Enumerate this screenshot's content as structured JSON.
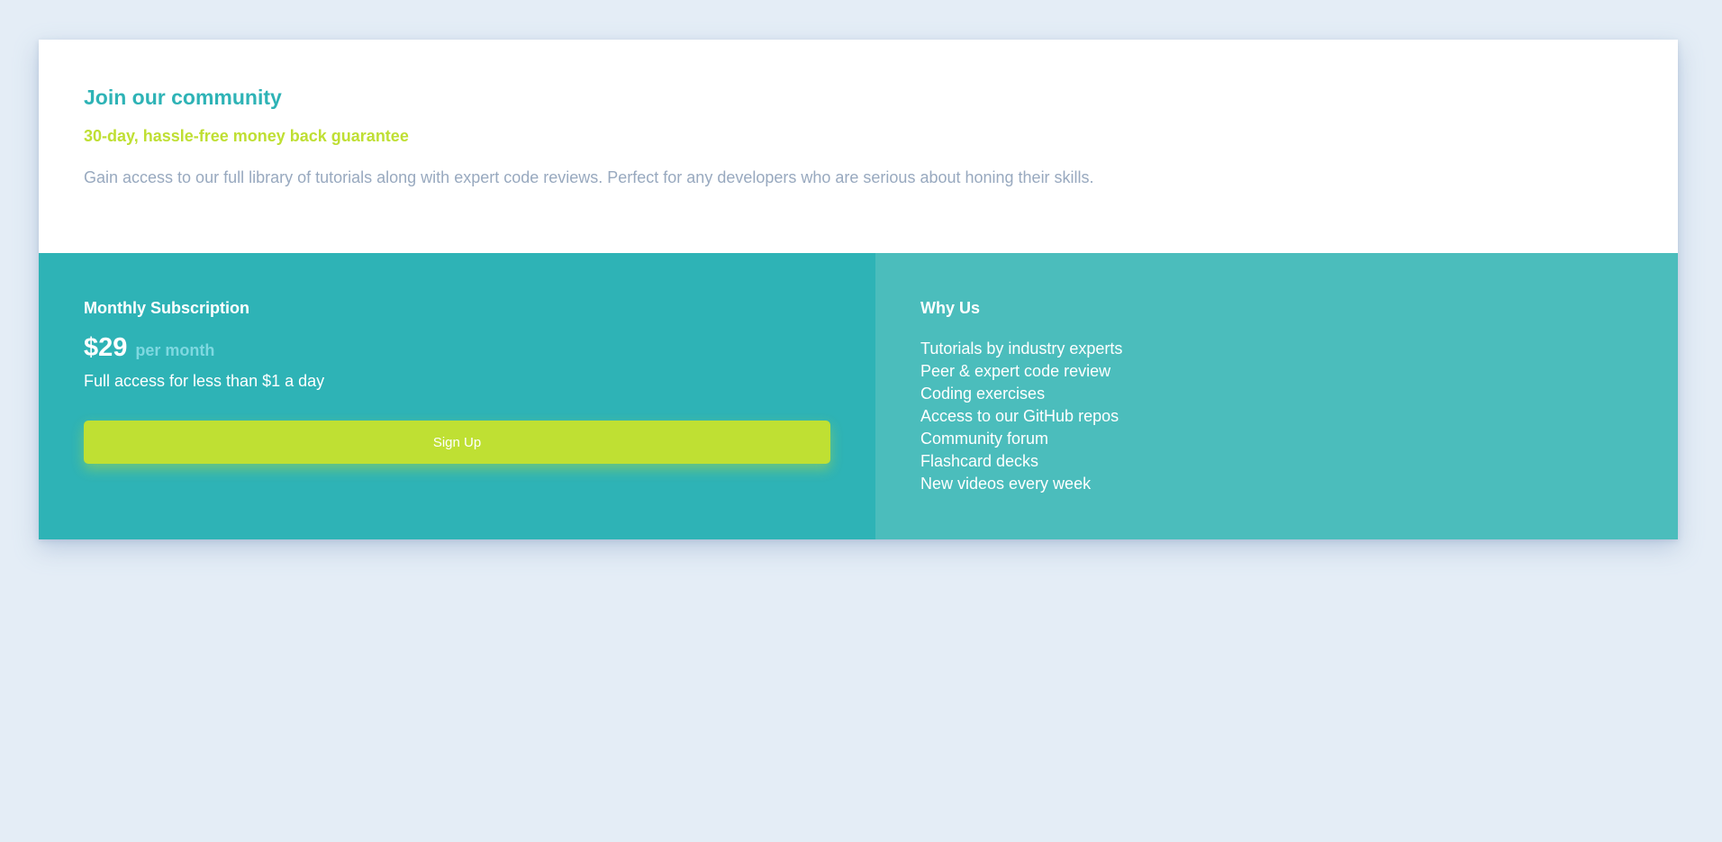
{
  "intro": {
    "title": "Join our community",
    "subtitle": "30-day, hassle-free money back guarantee",
    "description": "Gain access to our full library of tutorials along with expert code reviews. Perfect for any developers who are serious about honing their skills."
  },
  "subscription": {
    "title": "Monthly Subscription",
    "price": "$29",
    "period": "per month",
    "note": "Full access for less than $1 a day",
    "button_label": "Sign Up"
  },
  "why_us": {
    "title": "Why Us",
    "items": [
      "Tutorials by industry experts",
      "Peer & expert code review",
      "Coding exercises",
      "Access to our GitHub repos",
      "Community forum",
      "Flashcard decks",
      "New videos every week"
    ]
  },
  "colors": {
    "background": "#e4edf6",
    "primary": "#2eb3b6",
    "secondary": "#4bbdbc",
    "accent": "#bfdf33",
    "muted_text": "#98a9bf",
    "light_text": "#7ed8e0"
  }
}
